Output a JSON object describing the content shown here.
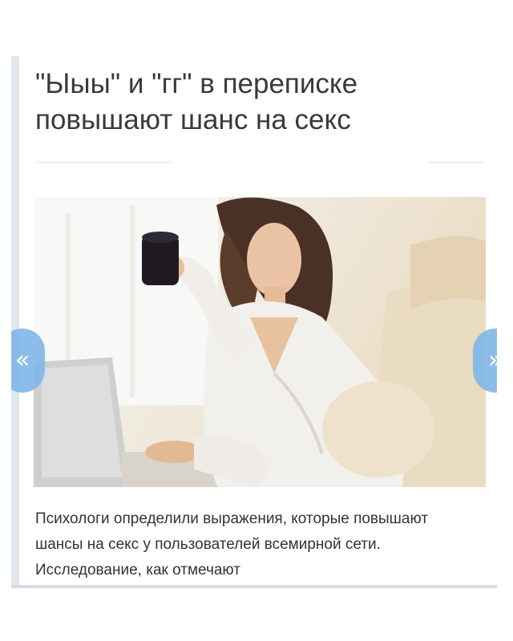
{
  "article": {
    "title": "\"Ыыы\" и \"гг\" в переписке повышают шанс на секс",
    "excerpt": "Психологи определили выражения, которые повышают шансы на секс у пользователей всемирной сети. Исследование, как отмечают",
    "image_icon": "woman-with-mug-at-laptop-photo"
  },
  "slider": {
    "prev_glyph": "«",
    "next_glyph": "»",
    "prev_icon": "double-chevron-left-icon",
    "next_icon": "double-chevron-right-icon",
    "arrow_color": "#7fb6e8"
  },
  "colors": {
    "title": "#3a3a3a",
    "body_text": "#333333",
    "accent_bar": "#dfe7ee"
  }
}
